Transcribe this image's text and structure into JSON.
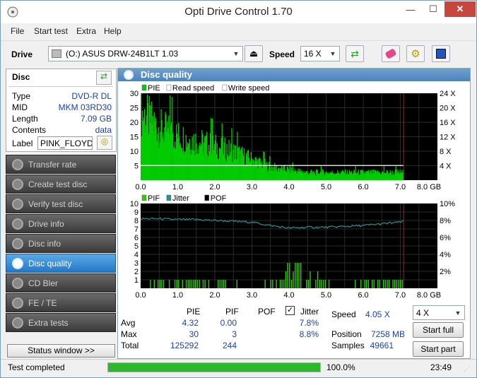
{
  "window": {
    "title": "Opti Drive Control 1.70",
    "minimize": "—",
    "maximize": "☐",
    "close": "✕"
  },
  "menu": [
    "File",
    "Start test",
    "Extra",
    "Help"
  ],
  "toolbar": {
    "drive_label": "Drive",
    "drive_value": "(O:)  ASUS DRW-24B1LT 1.03",
    "speed_label": "Speed",
    "speed_value": "16 X"
  },
  "disc": {
    "header": "Disc",
    "rows": [
      {
        "label": "Type",
        "value": "DVD-R DL"
      },
      {
        "label": "MID",
        "value": "MKM 03RD30"
      },
      {
        "label": "Length",
        "value": "7.09 GB"
      },
      {
        "label": "Contents",
        "value": "data"
      }
    ],
    "label_label": "Label",
    "label_value": "PINK_FLOYD_D"
  },
  "nav": [
    {
      "label": "Transfer rate",
      "active": false
    },
    {
      "label": "Create test disc",
      "active": false
    },
    {
      "label": "Verify test disc",
      "active": false
    },
    {
      "label": "Drive info",
      "active": false
    },
    {
      "label": "Disc info",
      "active": false
    },
    {
      "label": "Disc quality",
      "active": true
    },
    {
      "label": "CD Bler",
      "active": false
    },
    {
      "label": "FE / TE",
      "active": false
    },
    {
      "label": "Extra tests",
      "active": false
    }
  ],
  "status_window_button": "Status window >>",
  "panel_title": "Disc quality",
  "colors": {
    "pie": "#00cc00",
    "read": "#ffffff",
    "pif": "#33cc00",
    "jitter": "#2a8f8f",
    "marker": "#d01010",
    "accent": "#1c3fae"
  },
  "chart_data": [
    {
      "type": "bar",
      "legend": [
        "PIE",
        "Read speed",
        "Write speed"
      ],
      "x": [
        0.0,
        0.5,
        1.0,
        1.5,
        2.0,
        2.5,
        3.0,
        3.5,
        4.0,
        4.5,
        5.0,
        5.5,
        6.0,
        6.5,
        7.0,
        7.09
      ],
      "pie": [
        26,
        20,
        17,
        15,
        13,
        11,
        8,
        5,
        4,
        3,
        3,
        3,
        3,
        3,
        3,
        3
      ],
      "read_speed_x": 4.05,
      "xticks": [
        "0.0",
        "1.0",
        "2.0",
        "3.0",
        "4.0",
        "5.0",
        "6.0",
        "7.0",
        "8.0 GB"
      ],
      "yticks_left": [
        "5",
        "10",
        "15",
        "20",
        "25",
        "30"
      ],
      "yticks_right": [
        "4 X",
        "8 X",
        "12 X",
        "16 X",
        "20 X",
        "24 X"
      ],
      "ylim": [
        0,
        30
      ],
      "xlim": [
        0,
        8
      ],
      "end_marker": 7.09
    },
    {
      "type": "bar",
      "legend": [
        "PIF",
        "Jitter",
        "POF"
      ],
      "x": [
        0.0,
        0.5,
        1.0,
        1.5,
        2.0,
        2.5,
        3.0,
        3.5,
        4.0,
        4.5,
        5.0,
        5.5,
        6.0,
        6.5,
        7.0,
        7.09
      ],
      "jitter": [
        8.2,
        8.2,
        8.1,
        8.1,
        8.0,
        7.9,
        7.8,
        7.4,
        7.1,
        7.2,
        7.2,
        7.3,
        7.4,
        7.6,
        7.8,
        7.9
      ],
      "pif": [
        0,
        1,
        1,
        1,
        1,
        1,
        0,
        1,
        3,
        2,
        1,
        0,
        1,
        1,
        1,
        0
      ],
      "xticks": [
        "0.0",
        "1.0",
        "2.0",
        "3.0",
        "4.0",
        "5.0",
        "6.0",
        "7.0",
        "8.0 GB"
      ],
      "yticks_left": [
        "1",
        "2",
        "3",
        "4",
        "5",
        "6",
        "7",
        "8",
        "9",
        "10"
      ],
      "yticks_right": [
        "2%",
        "4%",
        "6%",
        "8%",
        "10%"
      ],
      "ylim": [
        0,
        10
      ],
      "xlim": [
        0,
        8
      ],
      "end_marker": 7.09
    }
  ],
  "stats": {
    "headers": [
      "PIE",
      "PIF",
      "POF",
      "Jitter"
    ],
    "rows": [
      {
        "label": "Avg",
        "pie": "4.32",
        "pif": "0.00",
        "pof": "",
        "jitter": "7.8%"
      },
      {
        "label": "Max",
        "pie": "30",
        "pif": "3",
        "pof": "",
        "jitter": "8.8%"
      },
      {
        "label": "Total",
        "pie": "125292",
        "pif": "244",
        "pof": "",
        "jitter": ""
      }
    ],
    "jitter_checked": true
  },
  "info": {
    "speed_label": "Speed",
    "speed_value": "4.05 X",
    "position_label": "Position",
    "position_value": "7258 MB",
    "samples_label": "Samples",
    "samples_value": "49661",
    "speed_select": "4 X",
    "start_full": "Start full",
    "start_part": "Start part"
  },
  "statusbar": {
    "text": "Test completed",
    "progress": 100,
    "progress_text": "100.0%",
    "time": "23:49"
  }
}
